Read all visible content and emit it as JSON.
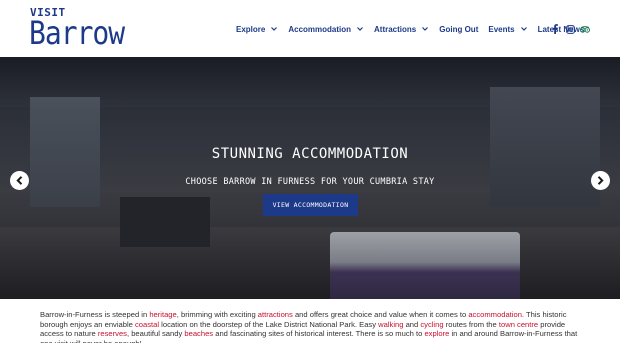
{
  "logo": {
    "line1": "VISIT",
    "line2": "Barrow"
  },
  "nav": {
    "items": [
      {
        "label": "Explore",
        "has_dropdown": true
      },
      {
        "label": "Accommodation",
        "has_dropdown": true
      },
      {
        "label": "Attractions",
        "has_dropdown": true
      },
      {
        "label": "Going Out",
        "has_dropdown": false
      },
      {
        "label": "Events",
        "has_dropdown": true
      },
      {
        "label": "Latest News",
        "has_dropdown": false
      }
    ]
  },
  "social": {
    "icons": [
      "facebook-icon",
      "instagram-icon",
      "tripadvisor-icon"
    ]
  },
  "hero": {
    "title": "STUNNING ACCOMMODATION",
    "subtitle": "CHOOSE BARROW IN FURNESS FOR YOUR CUMBRIA STAY",
    "button_label": "VIEW ACCOMMODATION"
  },
  "intro": {
    "segments": [
      {
        "text": "Barrow-in-Furness is steeped in ",
        "link": false
      },
      {
        "text": "heritage",
        "link": true
      },
      {
        "text": ", brimming with exciting ",
        "link": false
      },
      {
        "text": "attractions",
        "link": true
      },
      {
        "text": " and offers great choice  and value when it comes to ",
        "link": false
      },
      {
        "text": "accommodation",
        "link": true
      },
      {
        "text": ". This historic borough enjoys an enviable ",
        "link": false
      },
      {
        "text": "coastal",
        "link": true
      },
      {
        "text": " location on the doorstep of the Lake District National Park. Easy ",
        "link": false
      },
      {
        "text": "walking",
        "link": true
      },
      {
        "text": " and ",
        "link": false
      },
      {
        "text": "cycling",
        "link": true
      },
      {
        "text": " routes from the ",
        "link": false
      },
      {
        "text": "town centre",
        "link": true
      },
      {
        "text": " provide access to nature ",
        "link": false
      },
      {
        "text": "reserves",
        "link": true
      },
      {
        "text": ", beautiful sandy ",
        "link": false
      },
      {
        "text": "beaches",
        "link": true
      },
      {
        "text": " and fascinating sites of historical interest. There is so much to ",
        "link": false
      },
      {
        "text": "explore",
        "link": true
      },
      {
        "text": " in and around Barrow-in-Furness that one visit will never be enough!",
        "link": false
      }
    ]
  },
  "colors": {
    "brand": "#1d3a8a",
    "link": "#c8102e"
  }
}
